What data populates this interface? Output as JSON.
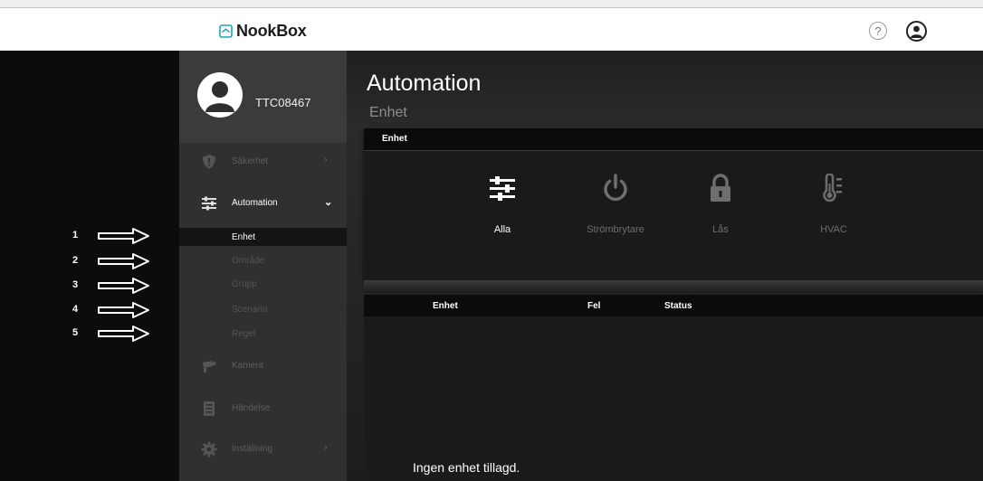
{
  "brand": {
    "name": "NookBox"
  },
  "header": {
    "help_icon": "?",
    "user_icon": "user-circle-icon"
  },
  "profile": {
    "name": "TTC08467"
  },
  "sidebar": {
    "items": [
      {
        "label": "Säkerhet",
        "icon": "shield-icon",
        "chevron": "›"
      },
      {
        "label": "Automation",
        "icon": "sliders-icon",
        "chevron": "⌄",
        "active": true
      },
      {
        "label": "Kamera",
        "icon": "camera-icon"
      },
      {
        "label": "Händelse",
        "icon": "list-icon"
      },
      {
        "label": "Inställning",
        "icon": "gear-icon",
        "chevron": "›"
      }
    ],
    "subitems": [
      {
        "label": "Enhet",
        "active": true
      },
      {
        "label": "Område"
      },
      {
        "label": "Grupp"
      },
      {
        "label": "Scenario"
      },
      {
        "label": "Regel"
      }
    ]
  },
  "annotations": {
    "arrows": [
      {
        "num": "1"
      },
      {
        "num": "2"
      },
      {
        "num": "3"
      },
      {
        "num": "4"
      },
      {
        "num": "5"
      }
    ],
    "arrow_color": "#ffffff"
  },
  "main": {
    "title": "Automation",
    "subtitle": "Enhet",
    "device_card": {
      "header": "Enhet",
      "categories": [
        {
          "label": "Alla",
          "icon": "sliders-icon",
          "active": true
        },
        {
          "label": "Strömbrytare",
          "icon": "power-icon"
        },
        {
          "label": "Lås",
          "icon": "lock-icon"
        },
        {
          "label": "HVAC",
          "icon": "thermometer-icon"
        }
      ]
    },
    "table": {
      "columns": [
        "Enhet",
        "Fel",
        "Status"
      ],
      "empty_message": "Ingen enhet tillagd."
    }
  },
  "colors": {
    "accent": "#ffffff",
    "muted": "#6e6e6e",
    "sidebar": "#303030",
    "background": "#000000"
  }
}
